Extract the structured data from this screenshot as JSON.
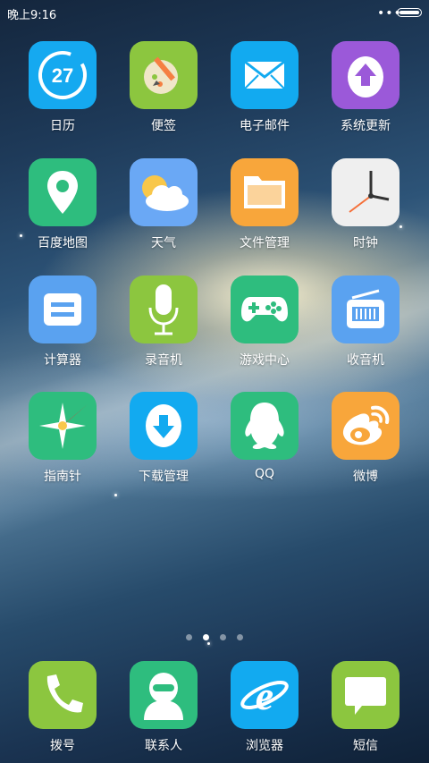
{
  "status_bar": {
    "time": "晚上9:16"
  },
  "grid": [
    {
      "id": "calendar",
      "label": "日历",
      "icon": "calendar-icon",
      "day": "27"
    },
    {
      "id": "notes",
      "label": "便签",
      "icon": "notes-icon"
    },
    {
      "id": "email",
      "label": "电子邮件",
      "icon": "mail-icon"
    },
    {
      "id": "system-update",
      "label": "系统更新",
      "icon": "update-icon"
    },
    {
      "id": "maps",
      "label": "百度地图",
      "icon": "map-pin-icon"
    },
    {
      "id": "weather",
      "label": "天气",
      "icon": "weather-icon"
    },
    {
      "id": "file-manager",
      "label": "文件管理",
      "icon": "folder-icon"
    },
    {
      "id": "clock",
      "label": "时钟",
      "icon": "clock-icon"
    },
    {
      "id": "calculator",
      "label": "计算器",
      "icon": "calculator-icon"
    },
    {
      "id": "recorder",
      "label": "录音机",
      "icon": "microphone-icon"
    },
    {
      "id": "game-center",
      "label": "游戏中心",
      "icon": "gamepad-icon"
    },
    {
      "id": "radio",
      "label": "收音机",
      "icon": "radio-icon"
    },
    {
      "id": "compass",
      "label": "指南针",
      "icon": "compass-icon"
    },
    {
      "id": "downloads",
      "label": "下载管理",
      "icon": "download-icon"
    },
    {
      "id": "qq",
      "label": "QQ",
      "icon": "qq-penguin-icon"
    },
    {
      "id": "weibo",
      "label": "微博",
      "icon": "weibo-icon"
    }
  ],
  "pager": {
    "count": 4,
    "active": 1
  },
  "dock": [
    {
      "id": "dialer",
      "label": "拨号",
      "icon": "phone-icon"
    },
    {
      "id": "contacts",
      "label": "联系人",
      "icon": "contacts-icon"
    },
    {
      "id": "browser",
      "label": "浏览器",
      "icon": "browser-icon"
    },
    {
      "id": "messages",
      "label": "短信",
      "icon": "message-icon"
    }
  ],
  "colors": {
    "calendar": "#15a9f0",
    "notes": "#8cc63f",
    "email": "#12aaf0",
    "system-update": "#9b59d9",
    "maps": "#2ebd7e",
    "weather": "#6aa8f5",
    "file-manager": "#f8a63b",
    "clock": "#efefef",
    "calculator": "#5aa2f0",
    "recorder": "#8cc63f",
    "game-center": "#2ebd7e",
    "radio": "#5aa2f0",
    "compass": "#2ebd7e",
    "downloads": "#12aaf0",
    "qq": "#2ebd7e",
    "weibo": "#f8a63b",
    "dialer": "#8cc63f",
    "contacts": "#2ebd7e",
    "browser": "#12aaf0",
    "messages": "#8cc63f"
  }
}
